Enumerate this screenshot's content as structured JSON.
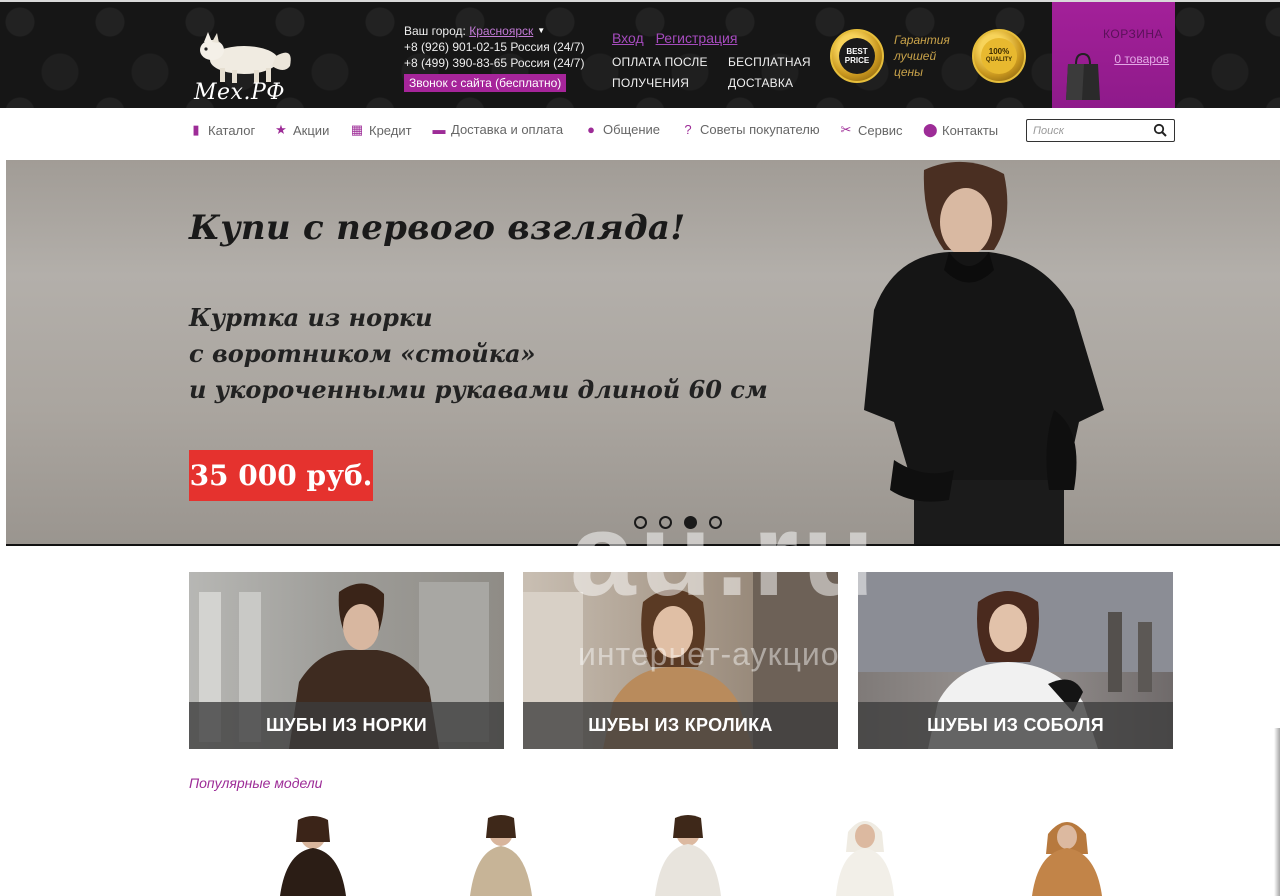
{
  "header": {
    "logo_text": "Мех.РФ",
    "city_label": "Ваш город:",
    "city_value": "Красноярск",
    "phones": [
      "+8 (926) 901-02-15 Россия (24/7)",
      "+8 (499) 390-83-65 Россия (24/7)"
    ],
    "callback_label": "Звонок с сайта (бесплатно)",
    "login_label": "Вход",
    "register_label": "Регистрация",
    "promo_payment": [
      "ОПЛАТА ПОСЛЕ",
      "ПОЛУЧЕНИЯ"
    ],
    "promo_delivery": [
      "БЕСПЛАТНАЯ",
      "ДОСТАВКА"
    ],
    "badge_best": [
      "BEST",
      "PRICE"
    ],
    "guarantee_text": [
      "Гарантия",
      "лучшей",
      "цены"
    ],
    "badge_quality": [
      "100%",
      "QUALITY"
    ],
    "cart_title": "КОРЗИНА",
    "cart_count": "0 товаров"
  },
  "nav": {
    "items": [
      {
        "label": "Каталог",
        "icon": "book-icon"
      },
      {
        "label": "Акции",
        "icon": "star-icon"
      },
      {
        "label": "Кредит",
        "icon": "gift-icon"
      },
      {
        "label": "Доставка и оплата",
        "icon": "card-icon"
      },
      {
        "label": "Общение",
        "icon": "chat-icon"
      },
      {
        "label": "Советы покупателю",
        "icon": "question-icon"
      },
      {
        "label": "Сервис",
        "icon": "scissors-icon"
      },
      {
        "label": "Контакты",
        "icon": "pin-icon"
      }
    ],
    "search_placeholder": "Поиск"
  },
  "hero": {
    "headline": "Купи с первого взгляда!",
    "desc_lines": [
      "Куртка из норки",
      "с воротником «стойка»",
      "и укороченными рукавами длиной 60 см"
    ],
    "price": "35 000 руб.",
    "slides_total": 4,
    "active_slide": 3
  },
  "watermark": {
    "main": "au.ru",
    "sub": "интернет-аукцион"
  },
  "categories": [
    {
      "label": "ШУБЫ ИЗ НОРКИ"
    },
    {
      "label": "ШУБЫ ИЗ КРОЛИКА"
    },
    {
      "label": "ШУБЫ ИЗ СОБОЛЯ"
    }
  ],
  "popular": {
    "title": "Популярные модели"
  },
  "colors": {
    "brand_purple": "#a6259a",
    "price_red": "#e5322e",
    "header_bg": "#161616"
  }
}
